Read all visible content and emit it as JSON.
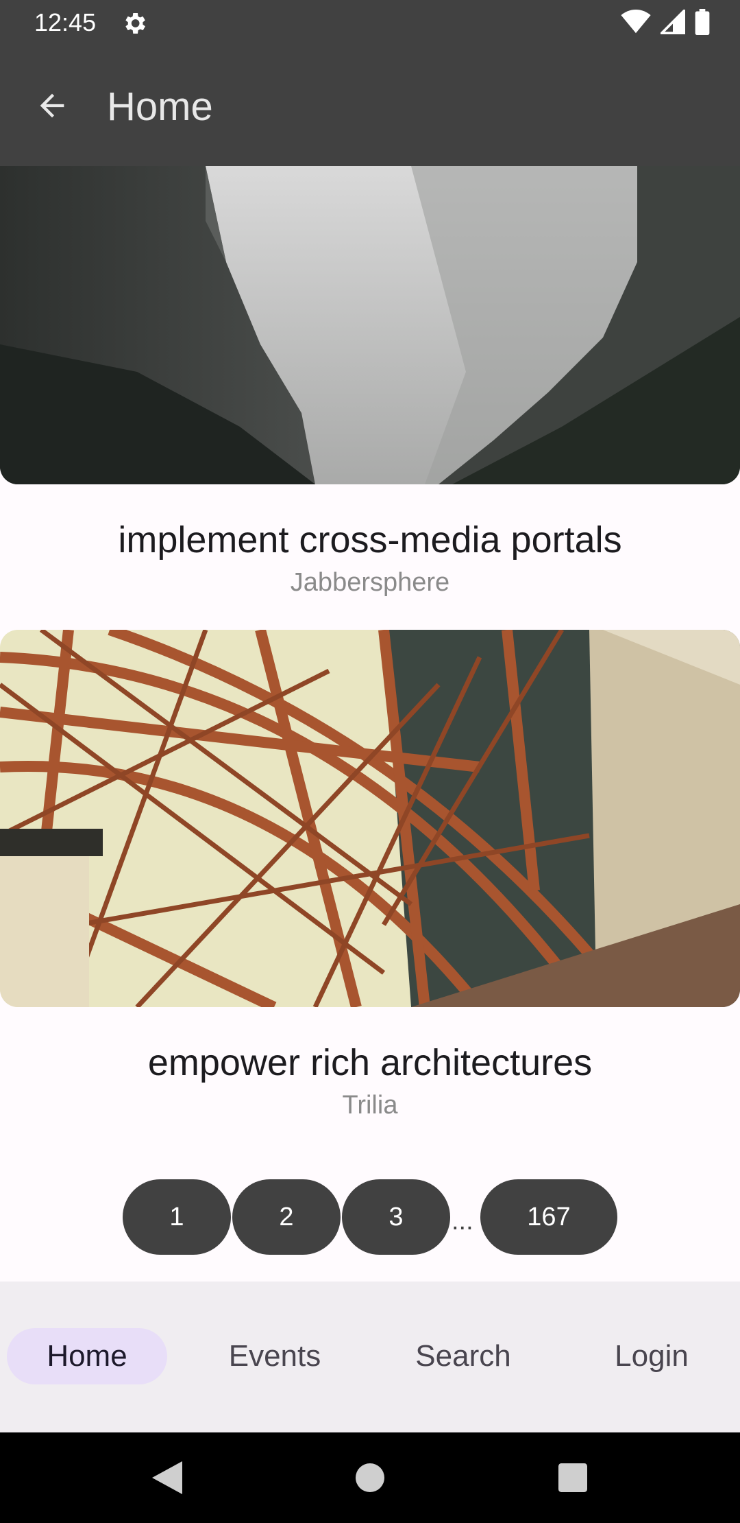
{
  "status_bar": {
    "time": "12:45",
    "icons": [
      "settings-gear-icon",
      "wifi-icon",
      "cell-signal-icon",
      "battery-icon"
    ]
  },
  "app_bar": {
    "title": "Home",
    "back_icon": "arrow-back-icon"
  },
  "cards": [
    {
      "title": "implement cross-media portals",
      "subtitle": "Jabbersphere",
      "image": "misty-canyon-photo"
    },
    {
      "title": "empower rich architectures",
      "subtitle": "Trilia",
      "image": "steel-bridge-photo"
    }
  ],
  "pagination": {
    "pages": [
      "1",
      "2",
      "3"
    ],
    "ellipsis": "...",
    "last": "167"
  },
  "bottom_nav": {
    "items": [
      {
        "label": "Home",
        "active": true
      },
      {
        "label": "Events",
        "active": false
      },
      {
        "label": "Search",
        "active": false
      },
      {
        "label": "Login",
        "active": false
      }
    ]
  },
  "system_nav": [
    "back-triangle-icon",
    "home-circle-icon",
    "recents-square-icon"
  ],
  "colors": {
    "app_bar": "#414141",
    "page_button": "#414141",
    "nav_active": "#e8def8",
    "nav_background": "#f0edf1",
    "background": "#fffbfe"
  }
}
